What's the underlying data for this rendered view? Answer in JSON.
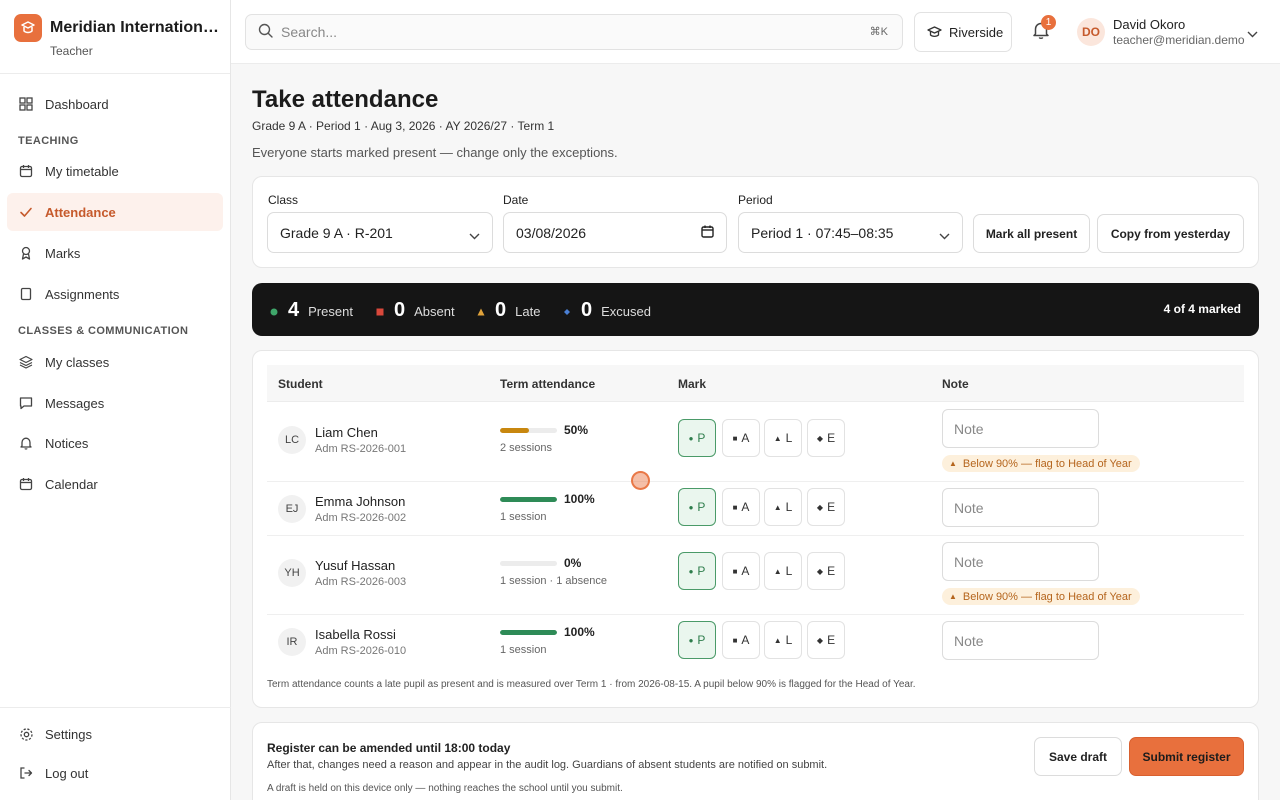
{
  "brand": {
    "name": "Meridian International School",
    "role": "Teacher",
    "accent": "#e8703d"
  },
  "nav": {
    "dashboard": "Dashboard",
    "section_teaching": "TEACHING",
    "timetable": "My timetable",
    "attendance": "Attendance",
    "marks": "Marks",
    "assignments": "Assignments",
    "section_classes": "CLASSES & COMMUNICATION",
    "my_classes": "My classes",
    "messages": "Messages",
    "notices": "Notices",
    "calendar": "Calendar",
    "settings": "Settings",
    "logout": "Log out"
  },
  "topbar": {
    "search_placeholder": "Search...",
    "search_shortcut": "⌘K",
    "campus": "Riverside",
    "notification_count": "1",
    "user_initials": "DO",
    "user_name": "David Okoro",
    "user_email": "teacher@meridian.demo"
  },
  "page": {
    "title": "Take attendance",
    "subtitle": "Grade 9 A · Period 1 · Aug 3, 2026 · AY 2026/27 · Term 1",
    "description": "Everyone starts marked present — change only the exceptions."
  },
  "filters": {
    "class_label": "Class",
    "class_value": "Grade 9 A · R-201",
    "date_label": "Date",
    "date_value": "03/08/2026",
    "period_label": "Period",
    "period_value": "Period 1 · 07:45–08:35",
    "mark_all": "Mark all present",
    "copy_yesterday": "Copy from yesterday"
  },
  "summary": {
    "present_count": "4",
    "present_label": "Present",
    "present_color": "#3fa66a",
    "absent_count": "0",
    "absent_label": "Absent",
    "absent_color": "#d9483b",
    "late_count": "0",
    "late_label": "Late",
    "late_color": "#e0a23a",
    "excused_count": "0",
    "excused_label": "Excused",
    "excused_color": "#4a7fd4",
    "marked": "4 of 4 marked"
  },
  "table": {
    "headers": {
      "student": "Student",
      "term": "Term attendance",
      "mark": "Mark",
      "note": "Note"
    },
    "mark_labels": {
      "p": "P",
      "a": "A",
      "l": "L",
      "e": "E"
    },
    "note_placeholder": "Note",
    "rows": [
      {
        "initials": "LC",
        "name": "Liam Chen",
        "adm": "Adm RS-2026-001",
        "pct": "50%",
        "fraction": 0.5,
        "bar_color": "#c8870f",
        "sessions": "2 sessions",
        "flag": "Below 90% — flag to Head of Year",
        "mark": "P"
      },
      {
        "initials": "EJ",
        "name": "Emma Johnson",
        "adm": "Adm RS-2026-002",
        "pct": "100%",
        "fraction": 1.0,
        "bar_color": "#2e8b57",
        "sessions": "1 session",
        "flag": "",
        "mark": "P"
      },
      {
        "initials": "YH",
        "name": "Yusuf Hassan",
        "adm": "Adm RS-2026-003",
        "pct": "0%",
        "fraction": 0.0,
        "bar_color": "#2e8b57",
        "sessions": "1 session · 1 absence",
        "flag": "Below 90% — flag to Head of Year",
        "mark": "P"
      },
      {
        "initials": "IR",
        "name": "Isabella Rossi",
        "adm": "Adm RS-2026-010",
        "pct": "100%",
        "fraction": 1.0,
        "bar_color": "#2e8b57",
        "sessions": "1 session",
        "flag": "",
        "mark": "P"
      }
    ],
    "footnote": "Term attendance counts a late pupil as present and is measured over Term 1 · from 2026-08-15. A pupil below 90% is flagged for the Head of Year."
  },
  "footer": {
    "title": "Register can be amended until 18:00 today",
    "subtitle": "After that, changes need a reason and appear in the audit log. Guardians of absent students are notified on submit.",
    "note": "A draft is held on this device only — nothing reaches the school until you submit.",
    "save_draft": "Save draft",
    "submit": "Submit register"
  }
}
